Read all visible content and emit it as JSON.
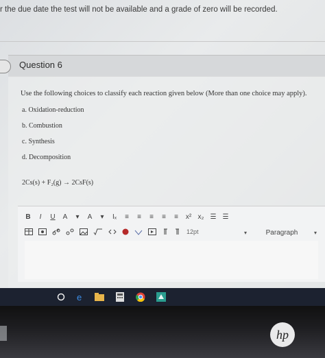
{
  "notice": {
    "text": "r the due date the test will not be available and a grade of zero will be recorded."
  },
  "question": {
    "title": "Question 6",
    "prompt": "Use the following choices to classify each reaction given below (More than one choice may apply).",
    "choices": [
      "a. Oxidation-reduction",
      "b. Combustion",
      "c. Synthesis",
      "d. Decomposition"
    ],
    "reaction": "2Cs(s) + F₂(g) → 2CsF(s)"
  },
  "editor": {
    "toolbar_row1": [
      "B",
      "I",
      "U",
      "A",
      "▾",
      "A",
      "▾",
      "Iₓ",
      "≡",
      "≡",
      "≡",
      "≡",
      "≡",
      "x²",
      "x₂",
      "☰",
      "☰"
    ],
    "font_size": "12pt",
    "paragraph_label": "Paragraph"
  },
  "taskbar": {
    "icons": [
      "circle-icon",
      "edge-icon",
      "file-explorer-icon",
      "calculator-icon",
      "chrome-icon",
      "app-icon"
    ]
  },
  "device": {
    "brand": "hp"
  }
}
